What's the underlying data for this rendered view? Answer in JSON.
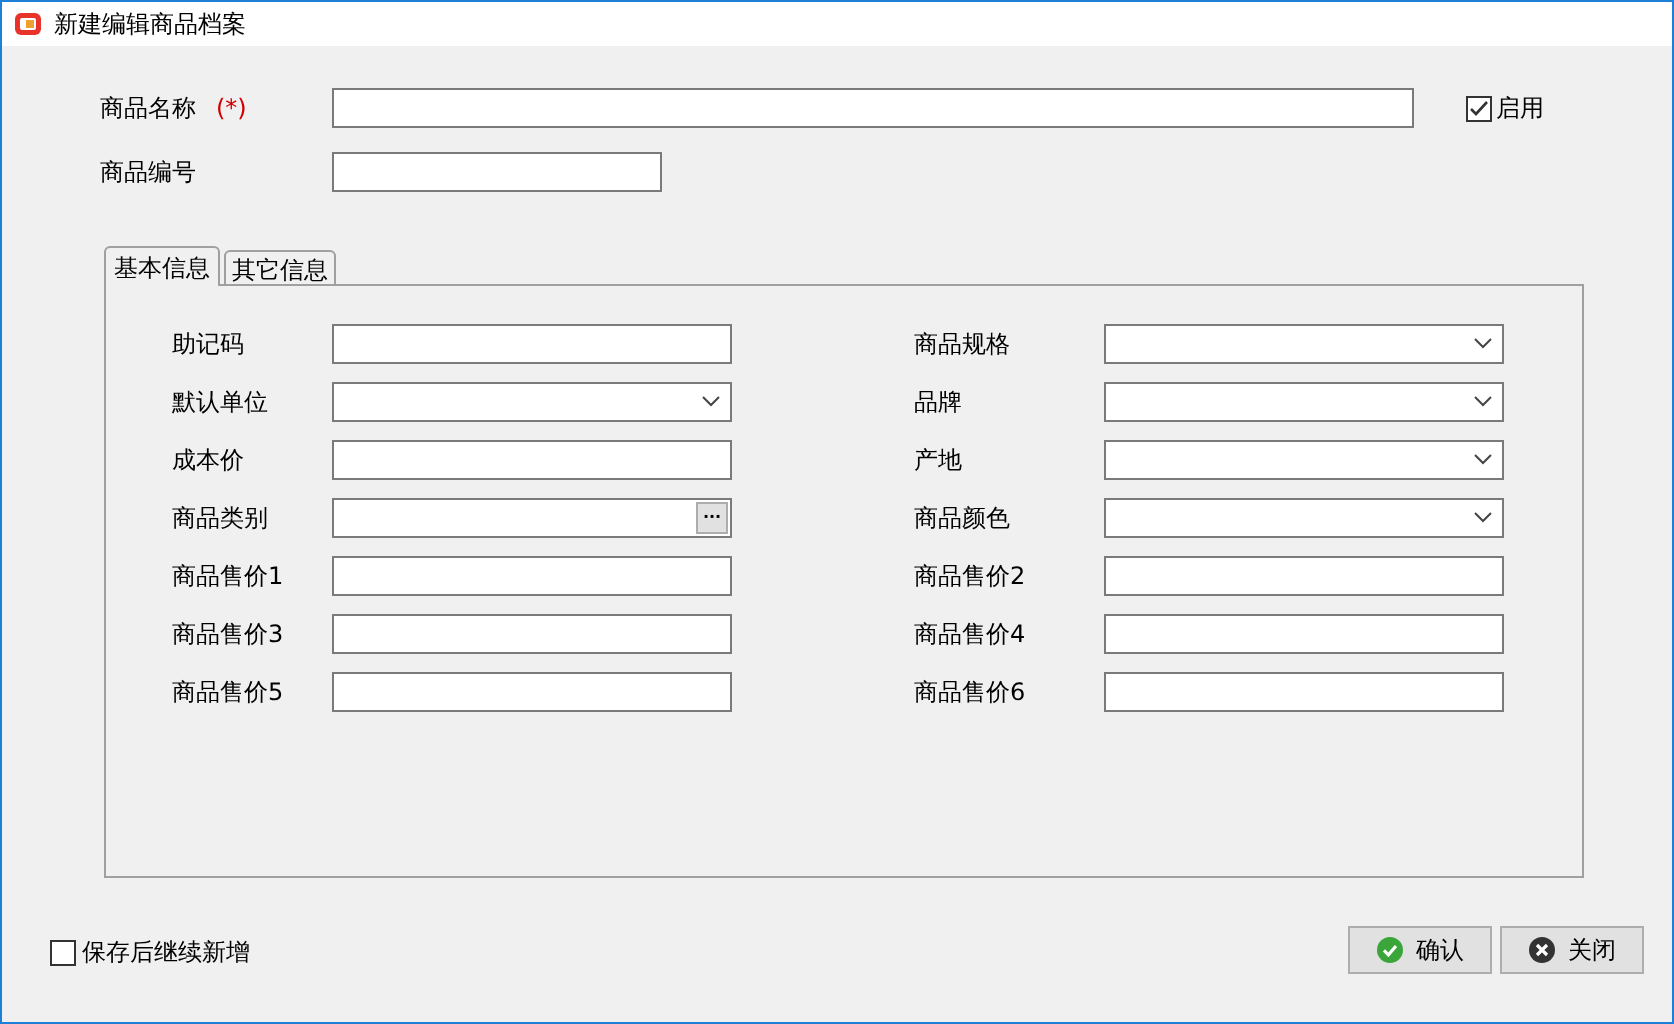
{
  "window": {
    "title": "新建编辑商品档案"
  },
  "header_fields": [
    {
      "label": "商品名称",
      "required_mark": "(*)",
      "wide": true
    },
    {
      "label": "商品编号",
      "wide": false
    }
  ],
  "enabled": {
    "label": "启用",
    "checked": true
  },
  "tabs": [
    {
      "label": "基本信息",
      "selected": true
    },
    {
      "label": "其它信息",
      "selected": false
    }
  ],
  "fields_left": [
    {
      "label": "助记码",
      "kind": "text"
    },
    {
      "label": "默认单位",
      "kind": "dropdown"
    },
    {
      "label": "成本价",
      "kind": "text"
    },
    {
      "label": "商品类别",
      "kind": "browse",
      "button": "···"
    },
    {
      "label": "商品售价1",
      "kind": "text"
    },
    {
      "label": "商品售价3",
      "kind": "text"
    },
    {
      "label": "商品售价5",
      "kind": "text"
    }
  ],
  "fields_right": [
    {
      "label": "商品规格",
      "kind": "dropdown"
    },
    {
      "label": "品牌",
      "kind": "dropdown"
    },
    {
      "label": "产地",
      "kind": "dropdown"
    },
    {
      "label": "商品颜色",
      "kind": "dropdown"
    },
    {
      "label": "商品售价2",
      "kind": "text"
    },
    {
      "label": "商品售价4",
      "kind": "text"
    },
    {
      "label": "商品售价6",
      "kind": "text"
    }
  ],
  "continue_option": {
    "label": "保存后继续新增",
    "checked": false
  },
  "buttons": [
    {
      "label": "确认",
      "kind": "ok"
    },
    {
      "label": "关闭",
      "kind": "close"
    }
  ]
}
